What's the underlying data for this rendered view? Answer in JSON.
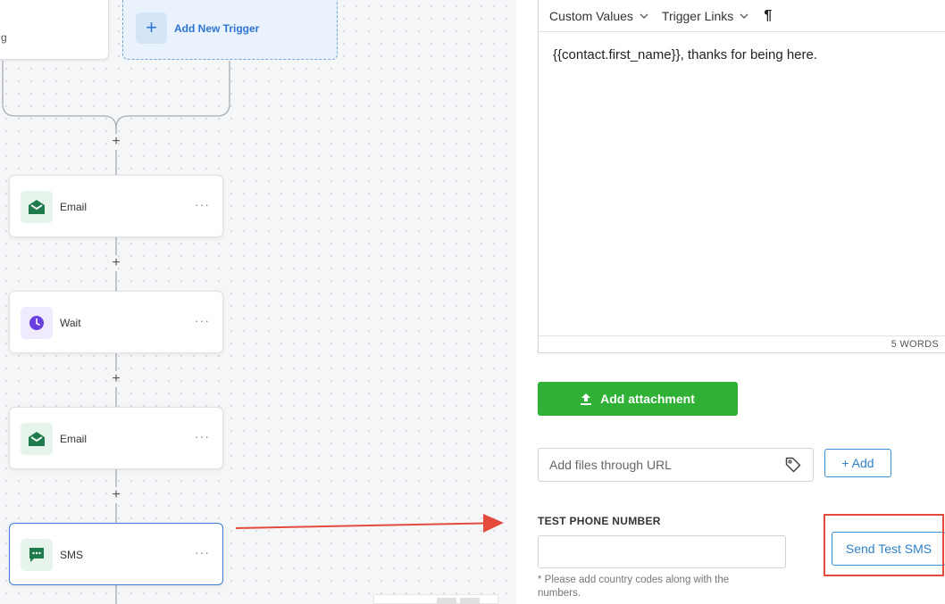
{
  "canvas": {
    "trigger_card_label": "g",
    "add_trigger": {
      "icon": "plus-icon",
      "label": "Add New Trigger"
    },
    "nodes": [
      {
        "label": "Email",
        "icon": "email-open-icon",
        "menu": "···"
      },
      {
        "label": "Wait",
        "icon": "clock-icon",
        "menu": "···"
      },
      {
        "label": "Email",
        "icon": "email-open-icon",
        "menu": "···"
      },
      {
        "label": "SMS",
        "icon": "sms-chat-icon",
        "menu": "···",
        "selected": true
      }
    ],
    "plus_label": "+"
  },
  "editor": {
    "toolbar": {
      "custom_values": "Custom Values",
      "trigger_links": "Trigger Links",
      "paragraph": "¶"
    },
    "body": "{{contact.first_name}}, thanks for being here.",
    "word_count": "5 WORDS"
  },
  "attachment": {
    "button_label": "Add attachment",
    "icon": "upload-icon"
  },
  "url_field": {
    "placeholder": "Add files through URL",
    "icon": "tag-icon",
    "add_label": "+ Add"
  },
  "test_phone": {
    "label": "TEST PHONE NUMBER",
    "value": "",
    "hint": "* Please add country codes along with the numbers.",
    "send_label": "Send Test SMS"
  },
  "colors": {
    "accent_blue": "#2f80c9",
    "green_button": "#2eb135",
    "annotation_red": "#e54b3c",
    "wait_purple": "#6a3fe0",
    "email_green": "#1f7a4c"
  }
}
